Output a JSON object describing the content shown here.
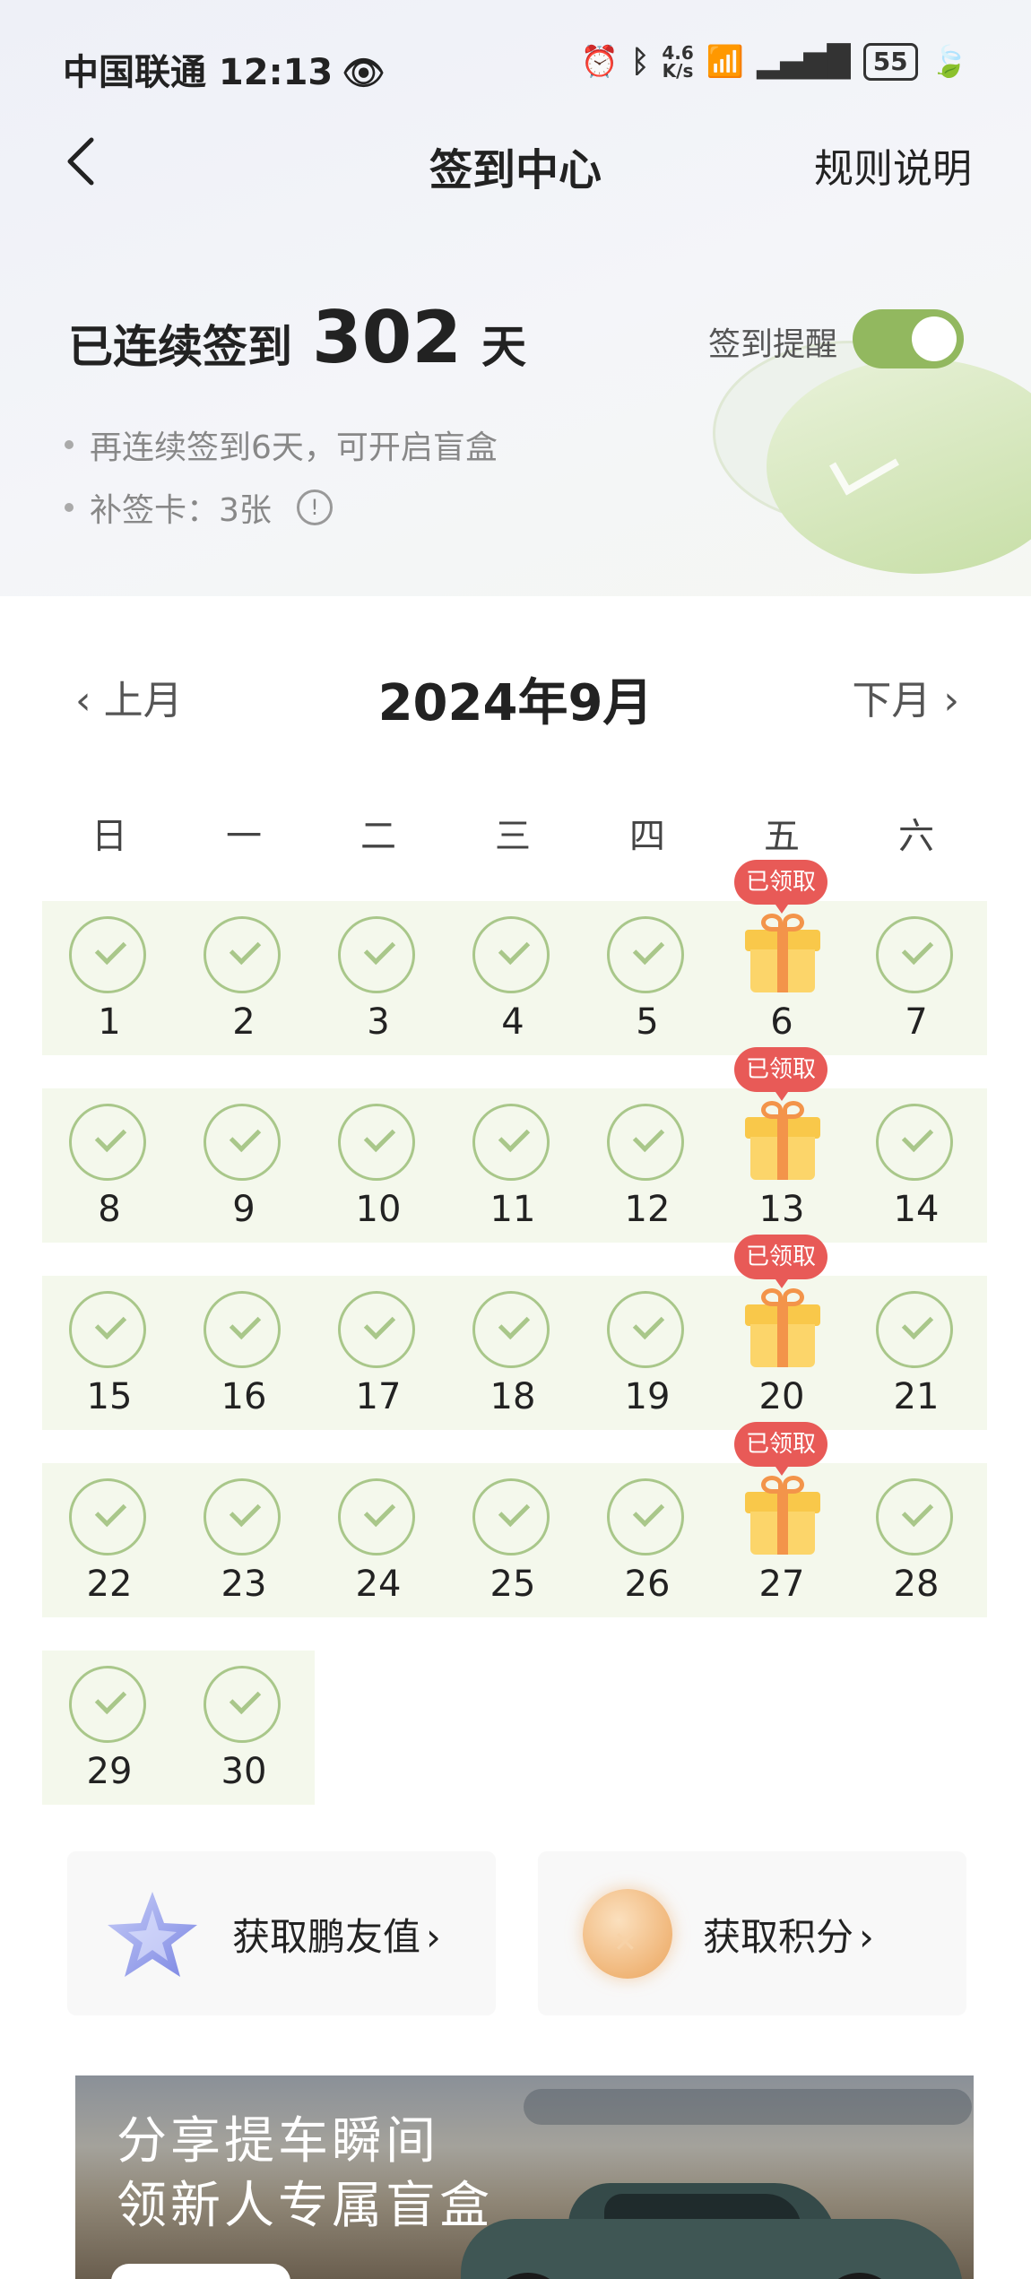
{
  "status_bar": {
    "carrier_time": "中国联通 12:13",
    "speed_top": "4.6",
    "speed_bottom": "K/s",
    "battery": "55"
  },
  "header": {
    "title": "签到中心",
    "rules_link": "规则说明"
  },
  "streak": {
    "prefix": "已连续签到",
    "days": "302",
    "suffix": "天",
    "reminder_label": "签到提醒",
    "reminder_on": true,
    "tips": [
      "再连续签到6天，可开启盲盒",
      "补签卡：3张"
    ]
  },
  "calendar": {
    "prev_label": "上月",
    "next_label": "下月",
    "month_title": "2024年9月",
    "weekdays": [
      "日",
      "一",
      "二",
      "三",
      "四",
      "五",
      "六"
    ],
    "days": [
      {
        "day": "1",
        "type": "checked"
      },
      {
        "day": "2",
        "type": "checked"
      },
      {
        "day": "3",
        "type": "checked"
      },
      {
        "day": "4",
        "type": "checked"
      },
      {
        "day": "5",
        "type": "checked"
      },
      {
        "day": "6",
        "type": "gift",
        "badge": "已领取"
      },
      {
        "day": "7",
        "type": "checked"
      },
      {
        "day": "8",
        "type": "checked"
      },
      {
        "day": "9",
        "type": "checked"
      },
      {
        "day": "10",
        "type": "checked"
      },
      {
        "day": "11",
        "type": "checked"
      },
      {
        "day": "12",
        "type": "checked"
      },
      {
        "day": "13",
        "type": "gift",
        "badge": "已领取"
      },
      {
        "day": "14",
        "type": "checked"
      },
      {
        "day": "15",
        "type": "checked"
      },
      {
        "day": "16",
        "type": "checked"
      },
      {
        "day": "17",
        "type": "checked"
      },
      {
        "day": "18",
        "type": "checked"
      },
      {
        "day": "19",
        "type": "checked"
      },
      {
        "day": "20",
        "type": "gift",
        "badge": "已领取"
      },
      {
        "day": "21",
        "type": "checked"
      },
      {
        "day": "22",
        "type": "checked"
      },
      {
        "day": "23",
        "type": "checked"
      },
      {
        "day": "24",
        "type": "checked"
      },
      {
        "day": "25",
        "type": "checked"
      },
      {
        "day": "26",
        "type": "checked"
      },
      {
        "day": "27",
        "type": "gift",
        "badge": "已领取"
      },
      {
        "day": "28",
        "type": "checked"
      },
      {
        "day": "29",
        "type": "checked"
      },
      {
        "day": "30",
        "type": "checked"
      }
    ]
  },
  "cards": [
    {
      "label": "获取鹏友值",
      "icon": "star-icon"
    },
    {
      "label": "获取积分",
      "icon": "coin-icon"
    }
  ],
  "banner": {
    "line1": "分享提车瞬间",
    "line2": "领新人专属盲盒"
  }
}
